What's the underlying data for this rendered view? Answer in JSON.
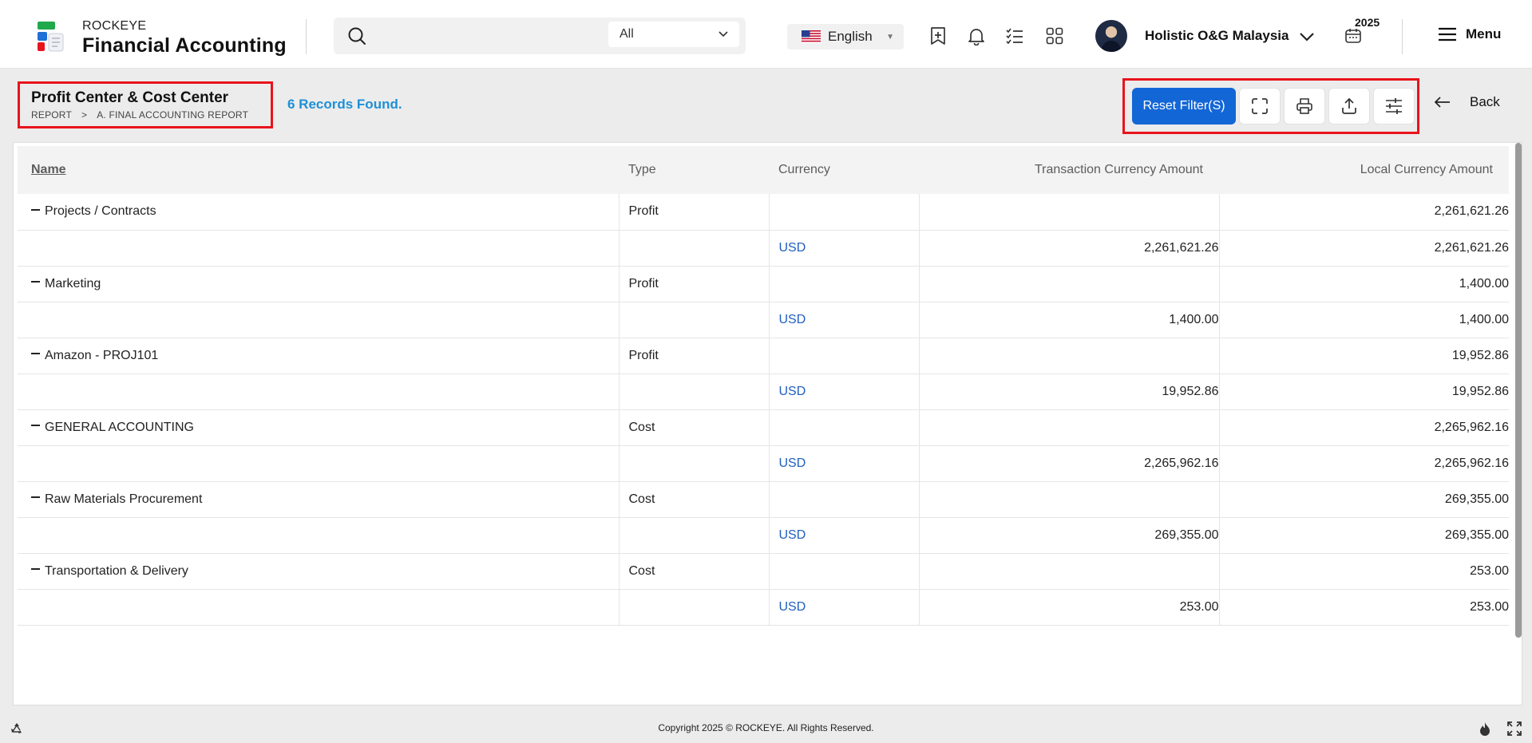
{
  "colors": {
    "accent": "#1366d6",
    "records": "#1e90d6",
    "highlight": "#e8141c",
    "currency_link": "#1f5fbf"
  },
  "header": {
    "brand_small": "ROCKEYE",
    "brand_title": "Financial Accounting",
    "search": {
      "placeholder": "",
      "scope": "All",
      "icon": "search-icon"
    },
    "language": "English",
    "icons": [
      "bookmark-add-icon",
      "bell-icon",
      "checklist-icon",
      "apps-grid-icon"
    ],
    "company": "Holistic O&G Malaysia",
    "year": "2025",
    "menu_label": "Menu"
  },
  "page": {
    "title": "Profit Center & Cost Center",
    "breadcrumb": {
      "root": "REPORT",
      "separator": ">",
      "current": "A. FINAL ACCOUNTING REPORT"
    },
    "records_found": "6 Records Found.",
    "toolbar": {
      "reset_label": "Reset Filter(S)",
      "icons": [
        "fullscreen-icon",
        "print-icon",
        "upload-icon",
        "sliders-icon"
      ]
    },
    "back_label": "Back"
  },
  "table": {
    "columns": [
      "Name",
      "Type",
      "Currency",
      "Transaction Currency Amount",
      "Local Currency Amount"
    ],
    "groups": [
      {
        "name": "Projects / Contracts",
        "type": "Profit",
        "local": "2,261,621.26",
        "detail": {
          "currency": "USD",
          "transaction": "2,261,621.26",
          "local": "2,261,621.26"
        }
      },
      {
        "name": "Marketing",
        "type": "Profit",
        "local": "1,400.00",
        "detail": {
          "currency": "USD",
          "transaction": "1,400.00",
          "local": "1,400.00"
        }
      },
      {
        "name": "Amazon - PROJ101",
        "type": "Profit",
        "local": "19,952.86",
        "detail": {
          "currency": "USD",
          "transaction": "19,952.86",
          "local": "19,952.86"
        }
      },
      {
        "name": "GENERAL ACCOUNTING",
        "type": "Cost",
        "local": "2,265,962.16",
        "detail": {
          "currency": "USD",
          "transaction": "2,265,962.16",
          "local": "2,265,962.16"
        }
      },
      {
        "name": "Raw Materials Procurement",
        "type": "Cost",
        "local": "269,355.00",
        "detail": {
          "currency": "USD",
          "transaction": "269,355.00",
          "local": "269,355.00"
        }
      },
      {
        "name": "Transportation & Delivery",
        "type": "Cost",
        "local": "253.00",
        "detail": {
          "currency": "USD",
          "transaction": "253.00",
          "local": "253.00"
        }
      }
    ]
  },
  "footer": {
    "copyright": "Copyright 2025 © ROCKEYE. All Rights Reserved."
  }
}
